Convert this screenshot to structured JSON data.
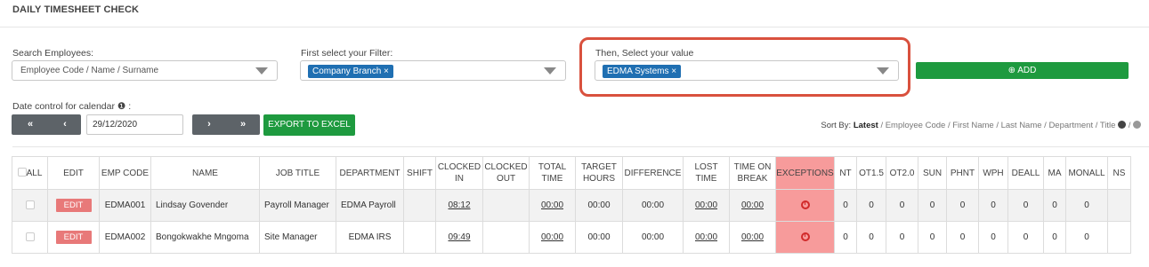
{
  "page": {
    "title": "DAILY TIMESHEET CHECK"
  },
  "filters": {
    "search": {
      "label": "Search Employees:",
      "placeholder": "Employee Code / Name / Surname"
    },
    "filter": {
      "label": "First select your Filter:",
      "tag": "Company Branch ×"
    },
    "value": {
      "label": "Then, Select your value",
      "tag": "EDMA Systems ×"
    },
    "add_label": "⊕ ADD"
  },
  "date_control": {
    "label": "Date control for calendar ❶ :",
    "first": "«",
    "prev": "‹",
    "next": "›",
    "last": "»",
    "date": "29/12/2020",
    "export_label": "EXPORT TO EXCEL"
  },
  "sort": {
    "label": "Sort By:",
    "active": "Latest",
    "options": " / Employee Code / First Name / Last Name / Department / Title "
  },
  "table": {
    "headers": {
      "all": "ALL",
      "edit": "EDIT",
      "emp_code": "EMP CODE",
      "name": "NAME",
      "job_title": "JOB TITLE",
      "department": "DEPARTMENT",
      "shift": "SHIFT",
      "clocked_in": "CLOCKED IN",
      "clocked_out": "CLOCKED OUT",
      "total_time": "TOTAL TIME",
      "target_hours": "TARGET HOURS",
      "difference": "DIFFERENCE",
      "lost_time": "LOST TIME",
      "time_on_break": "TIME ON BREAK",
      "exceptions": "EXCEPTIONS",
      "nt": "NT",
      "ot15": "OT1.5",
      "ot20": "OT2.0",
      "sun": "SUN",
      "phnt": "PHNT",
      "wph": "WPH",
      "deall": "DEALL",
      "ma": "MA",
      "monall": "MONALL",
      "ns": "NS"
    },
    "rows": [
      {
        "edit": "EDIT",
        "emp_code": "EDMA001",
        "name": "Lindsay Govender",
        "job_title": "Payroll Manager",
        "department": "EDMA Payroll",
        "shift": "",
        "clocked_in": "08:12",
        "clocked_out": "",
        "total_time": "00:00",
        "target_hours": "00:00",
        "difference": "00:00",
        "lost_time": "00:00",
        "time_on_break": "00:00",
        "nt": "0",
        "ot15": "0",
        "ot20": "0",
        "sun": "0",
        "phnt": "0",
        "wph": "0",
        "deall": "0",
        "ma": "0",
        "monall": "0",
        "ns": ""
      },
      {
        "edit": "EDIT",
        "emp_code": "EDMA002",
        "name": "Bongokwakhe Mngoma",
        "job_title": "Site Manager",
        "department": "EDMA IRS",
        "shift": "",
        "clocked_in": "09:49",
        "clocked_out": "",
        "total_time": "00:00",
        "target_hours": "00:00",
        "difference": "00:00",
        "lost_time": "00:00",
        "time_on_break": "00:00",
        "nt": "0",
        "ot15": "0",
        "ot20": "0",
        "sun": "0",
        "phnt": "0",
        "wph": "0",
        "deall": "0",
        "ma": "0",
        "monall": "0",
        "ns": ""
      }
    ]
  },
  "colors": {
    "primary_green": "#1e9a3f",
    "tag_blue": "#1f6fb2",
    "highlight_red": "#d9513e",
    "exception_red": "#f79b9b"
  },
  "icons": {
    "caret": "chevron-down-icon",
    "add": "plus-circle-icon",
    "info": "info-icon",
    "exception": "alarm-clock-icon"
  }
}
